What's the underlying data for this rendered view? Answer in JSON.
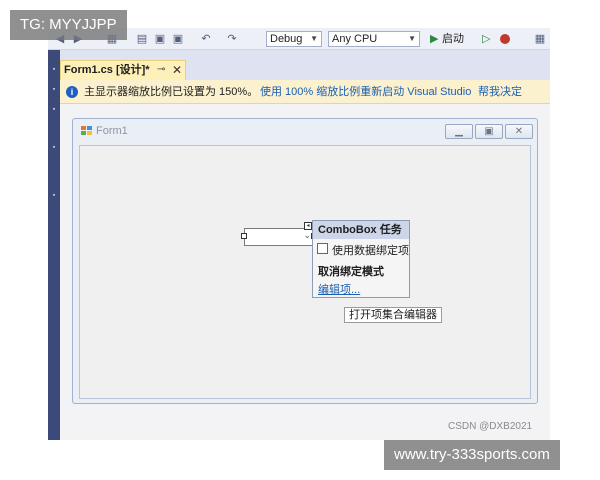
{
  "watermarks": {
    "top_left": "TG: MYYJJPP",
    "bottom_right": "www.try-333sports.com"
  },
  "toolbar": {
    "config_select": "Debug",
    "platform_select": "Any CPU",
    "start_label": "启动"
  },
  "document_tab": {
    "title": "Form1.cs [设计]*"
  },
  "info_bar": {
    "message": "主显示器缩放比例已设置为 150%。",
    "link_restart": "使用 100% 缩放比例重新启动 Visual Studio",
    "link_help": "帮我决定"
  },
  "form": {
    "title": "Form1"
  },
  "combo_tasks": {
    "header": "ComboBox 任务",
    "checkbox_label": "使用数据绑定项",
    "section_label": "取消绑定模式",
    "edit_items_link": "编辑项..."
  },
  "tooltip": {
    "text": "打开项集合编辑器"
  },
  "credit": "CSDN @DXB2021",
  "colors": {
    "accent": "#3c4a7a",
    "tab_active": "#fdf0b8",
    "info_bar": "#fbf1cf",
    "link": "#1a5fb4",
    "panel_header": "#cdd6e8"
  }
}
